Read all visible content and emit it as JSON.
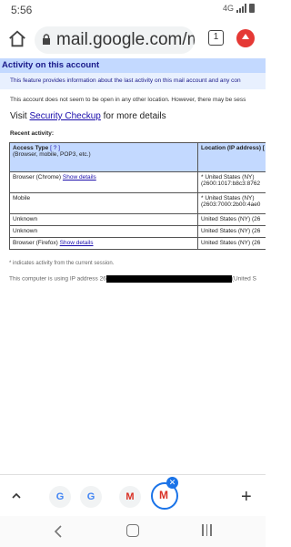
{
  "status": {
    "time": "5:56",
    "network": "4G"
  },
  "browser": {
    "url": "mail.google.com/m",
    "tab_count": "1"
  },
  "page": {
    "heading": "Activity on this account",
    "description": "This feature provides information about the last activity on this mail account and any con",
    "no_other_location": "This account does not seem to be open in any other location. However, there may be sess",
    "visit_prefix": "Visit ",
    "security_link": "Security Checkup",
    "visit_suffix": " for more details",
    "recent_label": "Recent activity:",
    "table": {
      "col1_header": "Access Type",
      "col1_help": "[ ? ]",
      "col1_sub": "(Browser, mobile, POP3, etc.)",
      "col2_header": "Location (IP address) [",
      "rows": [
        {
          "type": "Browser (Chrome)",
          "link": "Show details",
          "loc1": "* United States (NY)",
          "loc2": "(2600:1017:b8c3:8762"
        },
        {
          "type": "Mobile",
          "link": "",
          "loc1": "* United States (NY)",
          "loc2": "(2603:7000:2b00:4ae0"
        },
        {
          "type": "Unknown",
          "link": "",
          "loc1": "United States (NY) (26",
          "loc2": ""
        },
        {
          "type": "Unknown",
          "link": "",
          "loc1": "United States (NY) (26",
          "loc2": ""
        },
        {
          "type": "Browser (Firefox)",
          "link": "Show details",
          "loc1": "United States (NY) (26",
          "loc2": ""
        }
      ]
    },
    "footnote": "* indicates activity from the current session.",
    "ip_prefix": "This computer is using IP address 26",
    "ip_suffix": "(United S"
  },
  "tabs": {
    "thumbs": [
      "G",
      "G",
      "M"
    ],
    "active": "M"
  }
}
